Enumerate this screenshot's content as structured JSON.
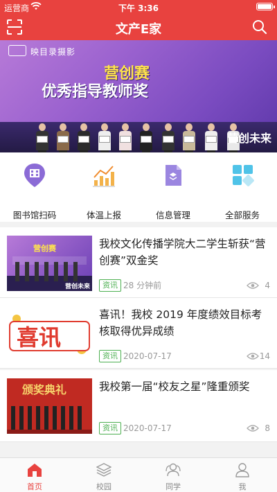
{
  "status": {
    "carrier": "运营商",
    "time": "下午 3:36"
  },
  "header": {
    "title": "文产E家",
    "scan_icon": "scan-icon",
    "search_icon": "search-icon"
  },
  "banner": {
    "brand": "映目录摄影",
    "title_line1": "营创赛",
    "title_line2": "优秀指导教师奖",
    "slogan": "营创未来"
  },
  "menu": [
    {
      "label": "图书馆扫码",
      "icon": "library-icon"
    },
    {
      "label": "体温上报",
      "icon": "temperature-chart-icon"
    },
    {
      "label": "信息管理",
      "icon": "document-icon"
    },
    {
      "label": "全部服务",
      "icon": "grid-icon"
    }
  ],
  "news": [
    {
      "title": "我校文化传播学院大二学生斩获“营创赛”双金奖",
      "tag": "资讯",
      "time": "28 分钟前",
      "views": "4"
    },
    {
      "title": "喜讯！我校 2019 年度绩效目标考核取得优异成绩",
      "tag": "资讯",
      "time": "2020-07-17",
      "views": "14",
      "thumb_text": "喜讯"
    },
    {
      "title": "我校第一届“校友之星”隆重颁奖",
      "tag": "资讯",
      "time": "2020-07-17",
      "views": "8",
      "thumb_text": "颁奖典礼"
    }
  ],
  "tabs": [
    {
      "label": "首页",
      "icon": "home-icon",
      "active": true
    },
    {
      "label": "校园",
      "icon": "layers-icon",
      "active": false
    },
    {
      "label": "同学",
      "icon": "classmates-icon",
      "active": false
    },
    {
      "label": "我",
      "icon": "person-icon",
      "active": false
    }
  ],
  "colors": {
    "primary": "#e8423f",
    "tag": "#4caf50",
    "muted": "#999999"
  }
}
